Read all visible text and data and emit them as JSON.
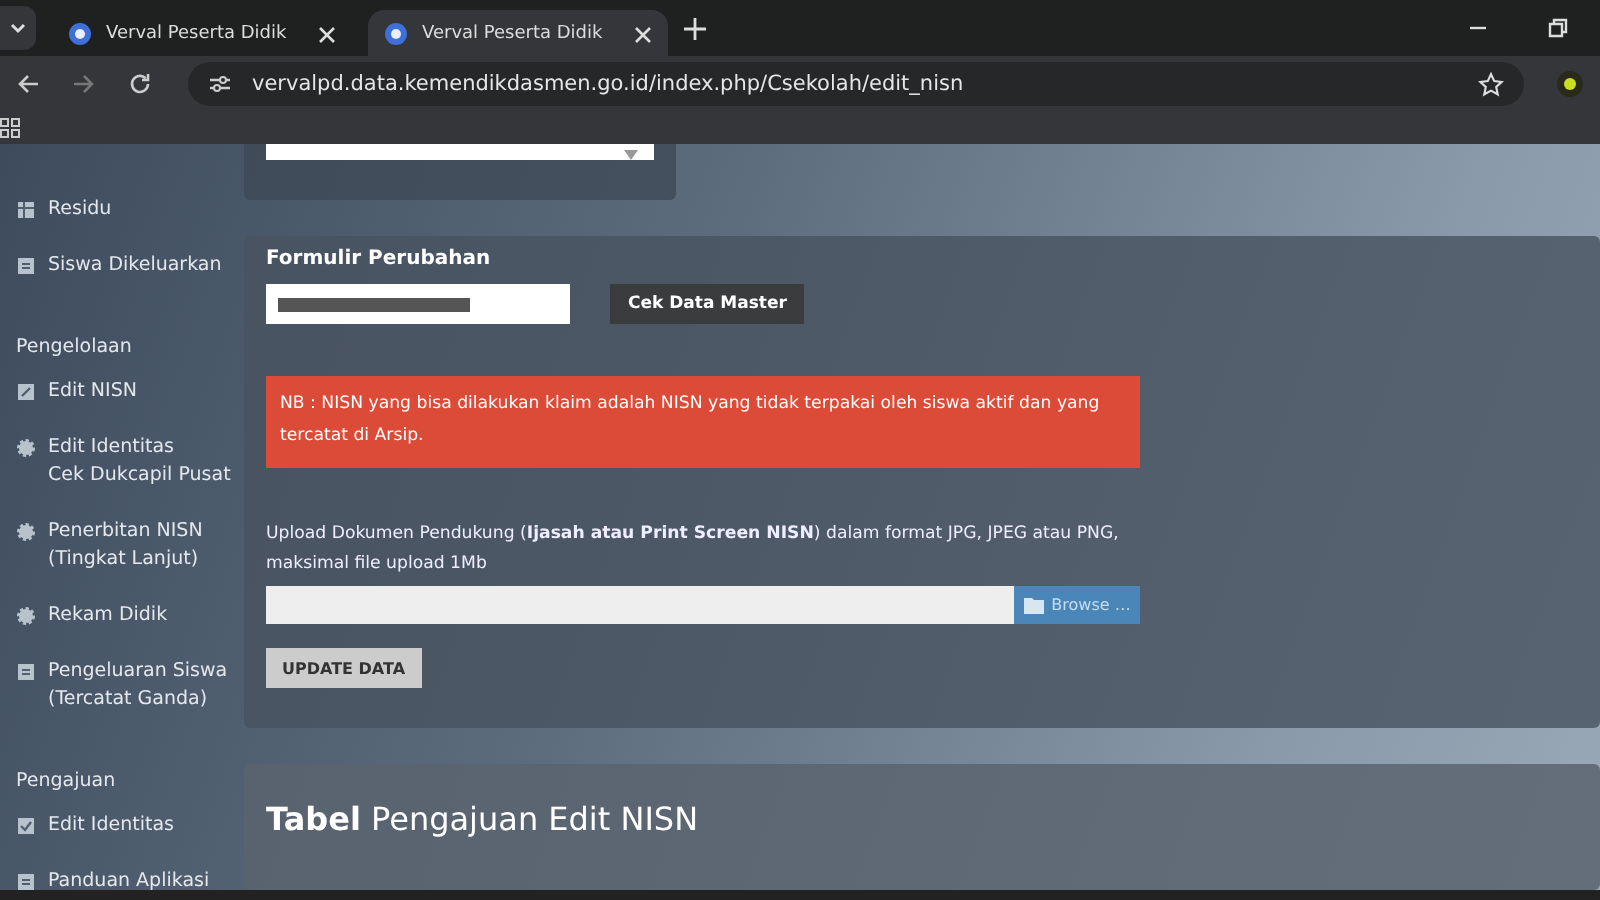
{
  "browser": {
    "tabs": [
      {
        "title": "Verval Peserta Didik",
        "selected": false
      },
      {
        "title": "Verval Peserta Didik",
        "selected": true
      }
    ],
    "url": "vervalpd.data.kemendikdasmen.go.id/index.php/Csekolah/edit_nisn"
  },
  "sidebar": {
    "top_items": [
      {
        "lines": [
          "Residu"
        ],
        "kind": "table"
      },
      {
        "lines": [
          "Siswa Dikeluarkan"
        ],
        "kind": "doc"
      }
    ],
    "sections": [
      {
        "heading": "Pengelolaan",
        "items": [
          {
            "lines": [
              "Edit NISN"
            ],
            "kind": "edit"
          },
          {
            "lines": [
              "Edit Identitas",
              "Cek Dukcapil Pusat"
            ],
            "kind": "gear"
          },
          {
            "lines": [
              "Penerbitan NISN",
              "(Tingkat Lanjut)"
            ],
            "kind": "gear"
          },
          {
            "lines": [
              "Rekam Didik"
            ],
            "kind": "gear"
          },
          {
            "lines": [
              "Pengeluaran Siswa",
              "(Tercatat Ganda)"
            ],
            "kind": "doc"
          }
        ]
      },
      {
        "heading": "Pengajuan",
        "items": [
          {
            "lines": [
              "Edit Identitas"
            ],
            "kind": "check"
          },
          {
            "lines": [
              "Panduan Aplikasi"
            ],
            "kind": "doc"
          }
        ]
      }
    ]
  },
  "form": {
    "title": "Formulir Perubahan",
    "nisn_redacted": true,
    "check_button": "Cek Data Master",
    "alert": "NB : NISN yang bisa dilakukan klaim adalah NISN yang tidak terpakai oleh siswa aktif dan yang tercatat di Arsip.",
    "upload_label": "Upload Dokumen Pendukung (**Ijasah atau Print Screen NISN**) dalam format JPG, JPEG atau PNG, maksimal file upload 1Mb",
    "browse_button": "Browse …",
    "submit_button": "UPDATE DATA"
  },
  "table_card": {
    "title_bold": "Tabel",
    "title_rest": "Pengajuan Edit NISN"
  }
}
